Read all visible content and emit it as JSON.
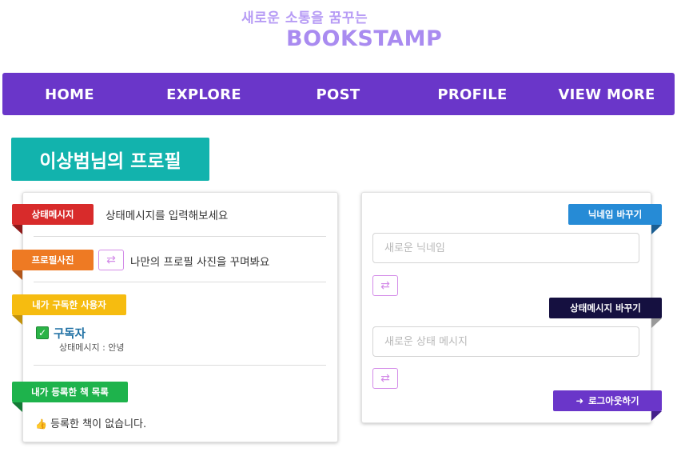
{
  "header": {
    "tagline": "새로운 소통을 꿈꾸는",
    "brand": "BOOKSTAMP"
  },
  "nav": {
    "items": [
      {
        "label": "HOME"
      },
      {
        "label": "EXPLORE"
      },
      {
        "label": "POST"
      },
      {
        "label": "PROFILE"
      },
      {
        "label": "VIEW MORE"
      }
    ]
  },
  "profile": {
    "title": "이상범님의 프로필",
    "status": {
      "label": "상태메시지",
      "text": "상태메시지를 입력해보세요"
    },
    "photo": {
      "label": "프로필사진",
      "text": "나만의 프로필 사진을 꾸며봐요",
      "swap_icon": "⇄"
    },
    "subscriptions": {
      "label": "내가 구독한 사용자",
      "items": [
        {
          "name": "구독자",
          "message": "상태메시지 : 안녕",
          "check_icon": "✓"
        }
      ]
    },
    "books": {
      "label": "내가 등록한 책 목록",
      "thumb_icon": "👍",
      "empty_text": "등록한 책이 없습니다."
    }
  },
  "settings": {
    "nickname": {
      "label": "닉네임 바꾸기",
      "placeholder": "새로운 닉네임",
      "value": "",
      "swap_icon": "⇄"
    },
    "status": {
      "label": "상태메시지 바꾸기",
      "placeholder": "새로운 상태 메시지",
      "value": "",
      "swap_icon": "⇄"
    },
    "logout": {
      "label": "로그아웃하기",
      "icon": "➜"
    }
  },
  "colors": {
    "brand_purple": "#6a36c9",
    "teal": "#12b3ad",
    "swap_pink": "#d38be8"
  }
}
